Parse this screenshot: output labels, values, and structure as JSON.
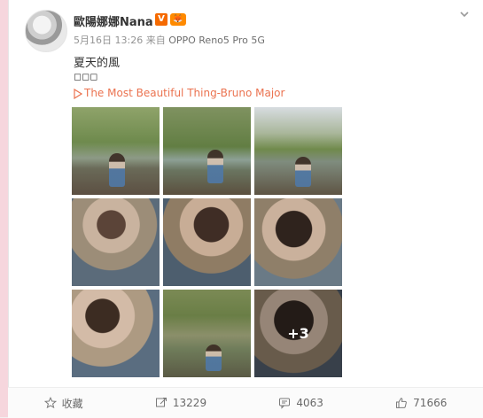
{
  "post": {
    "username": "歐陽娜娜Nana",
    "badges": {
      "verified": "V",
      "member": "🦊"
    },
    "timestamp": "5月16日 13:26 来自",
    "source": "OPPO Reno5 Pro 5G",
    "text_line1": "夏天的風",
    "text_line2": "◻◻◻",
    "music_link": "The Most Beautiful Thing-Bruno Major",
    "more_images_count": "+3"
  },
  "actions": {
    "favorite": "收藏",
    "repost": "13229",
    "comment": "4063",
    "like": "71666"
  },
  "icons": {
    "chevron": "chevron-down-icon",
    "play": "play-icon",
    "favorite": "star-icon",
    "repost": "repost-icon",
    "comment": "comment-icon",
    "like": "thumbs-up-icon"
  },
  "colors": {
    "link": "#eb7350",
    "badge_orange": "#f56a00",
    "text_primary": "#333333",
    "text_meta": "#939393"
  }
}
